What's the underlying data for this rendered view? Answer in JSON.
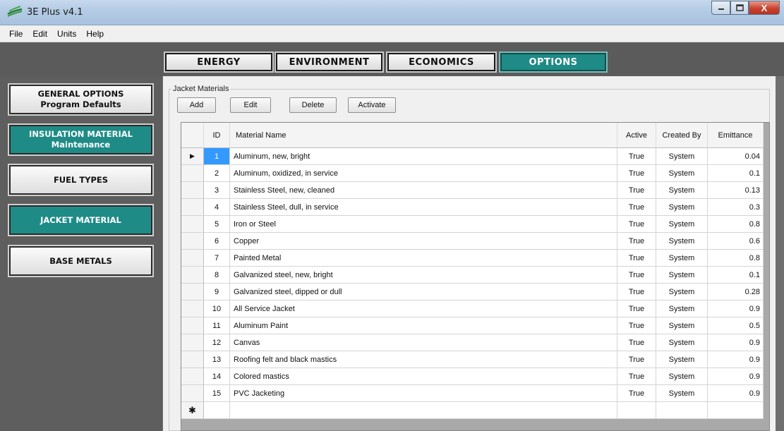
{
  "window": {
    "title": "3E Plus v4.1",
    "minimize": "–",
    "maximize": "□",
    "close": "X"
  },
  "menu": [
    "File",
    "Edit",
    "Units",
    "Help"
  ],
  "tabs": [
    "ENERGY",
    "ENVIRONMENT",
    "ECONOMICS",
    "OPTIONS"
  ],
  "active_tab": "OPTIONS",
  "nav": [
    {
      "line1": "GENERAL OPTIONS",
      "line2": "Program Defaults"
    },
    {
      "line1": "INSULATION MATERIAL",
      "line2": "Maintenance"
    },
    {
      "line1": "FUEL TYPES",
      "line2": ""
    },
    {
      "line1": "JACKET MATERIAL",
      "line2": ""
    },
    {
      "line1": "BASE METALS",
      "line2": ""
    }
  ],
  "panel": {
    "group_label": "Jacket Materials",
    "buttons": [
      "Add",
      "Edit",
      "Delete",
      "Activate"
    ]
  },
  "grid": {
    "headers": [
      "ID",
      "Material Name",
      "Active",
      "Created By",
      "Emittance"
    ],
    "current_row_glyph": "▶",
    "new_row_glyph": "✱",
    "rows": [
      {
        "id": "1",
        "name": "Aluminum, new, bright",
        "active": "True",
        "created_by": "System",
        "emittance": "0.04"
      },
      {
        "id": "2",
        "name": "Aluminum, oxidized, in service",
        "active": "True",
        "created_by": "System",
        "emittance": "0.1"
      },
      {
        "id": "3",
        "name": "Stainless Steel, new, cleaned",
        "active": "True",
        "created_by": "System",
        "emittance": "0.13"
      },
      {
        "id": "4",
        "name": "Stainless Steel, dull, in service",
        "active": "True",
        "created_by": "System",
        "emittance": "0.3"
      },
      {
        "id": "5",
        "name": "Iron or Steel",
        "active": "True",
        "created_by": "System",
        "emittance": "0.8"
      },
      {
        "id": "6",
        "name": "Copper",
        "active": "True",
        "created_by": "System",
        "emittance": "0.6"
      },
      {
        "id": "7",
        "name": "Painted Metal",
        "active": "True",
        "created_by": "System",
        "emittance": "0.8"
      },
      {
        "id": "8",
        "name": "Galvanized steel, new, bright",
        "active": "True",
        "created_by": "System",
        "emittance": "0.1"
      },
      {
        "id": "9",
        "name": "Galvanized steel, dipped or dull",
        "active": "True",
        "created_by": "System",
        "emittance": "0.28"
      },
      {
        "id": "10",
        "name": "All Service Jacket",
        "active": "True",
        "created_by": "System",
        "emittance": "0.9"
      },
      {
        "id": "11",
        "name": "Aluminum Paint",
        "active": "True",
        "created_by": "System",
        "emittance": "0.5"
      },
      {
        "id": "12",
        "name": "Canvas",
        "active": "True",
        "created_by": "System",
        "emittance": "0.9"
      },
      {
        "id": "13",
        "name": "Roofing felt and black mastics",
        "active": "True",
        "created_by": "System",
        "emittance": "0.9"
      },
      {
        "id": "14",
        "name": "Colored mastics",
        "active": "True",
        "created_by": "System",
        "emittance": "0.9"
      },
      {
        "id": "15",
        "name": "PVC Jacketing",
        "active": "True",
        "created_by": "System",
        "emittance": "0.9"
      }
    ]
  },
  "colors": {
    "accent_teal": "#1f8b86",
    "selection_blue": "#3399ff"
  }
}
